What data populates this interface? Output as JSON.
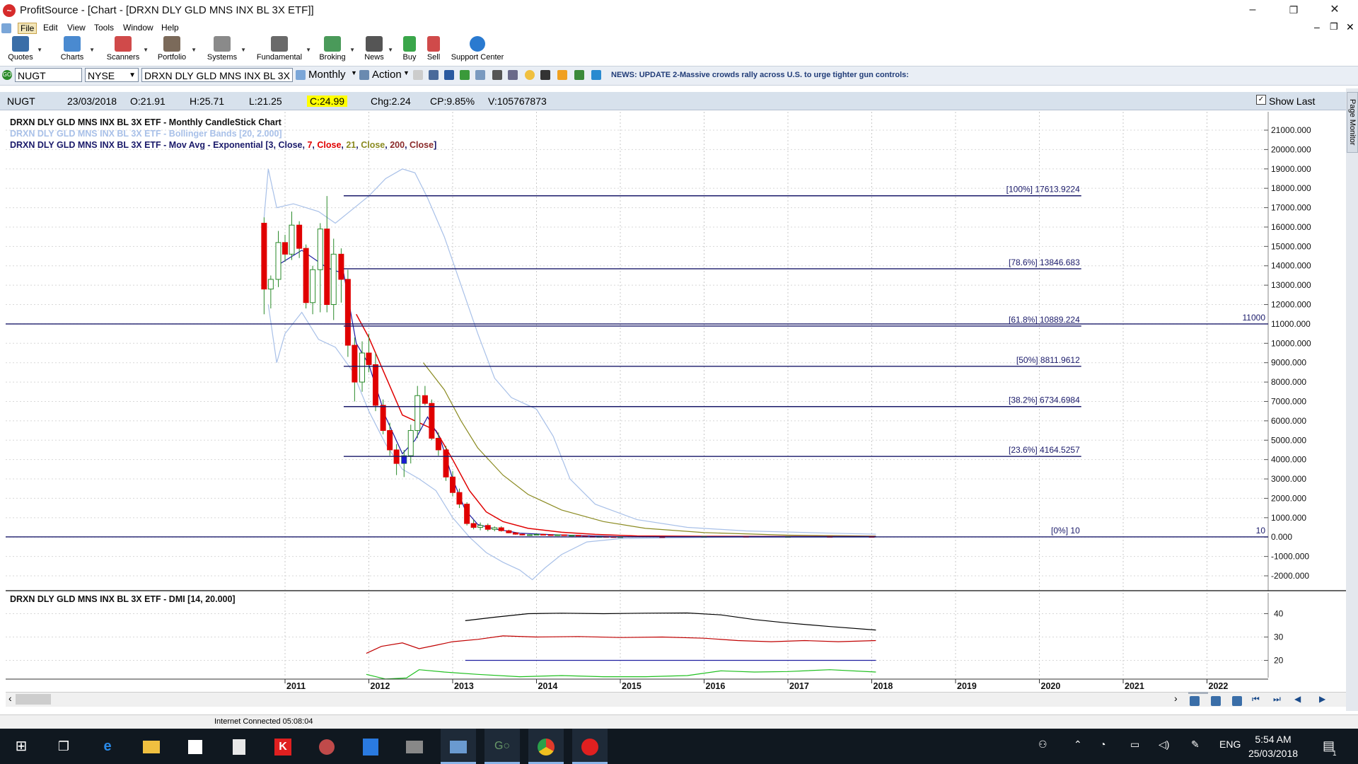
{
  "window": {
    "title": "ProfitSource - [Chart - [DRXN DLY GLD MNS INX BL 3X ETF]]",
    "controls": [
      "–",
      "❐",
      "✕"
    ],
    "mdi_controls": [
      "–",
      "❐",
      "✕"
    ]
  },
  "menu": [
    "File",
    "Edit",
    "View",
    "Tools",
    "Window",
    "Help"
  ],
  "toolbar": [
    {
      "label": "Quotes",
      "icon": "quotes-icon",
      "color": "#3a6ea8"
    },
    {
      "label": "Charts",
      "icon": "charts-icon",
      "color": "#4a8ad0"
    },
    {
      "label": "Scanners",
      "icon": "scanners-icon",
      "color": "#d04a4a"
    },
    {
      "label": "Portfolio",
      "icon": "portfolio-icon",
      "color": "#7b6a5a"
    },
    {
      "label": "Systems",
      "icon": "systems-icon",
      "color": "#8a8a8a"
    },
    {
      "label": "Fundamental",
      "icon": "fundamental-icon",
      "color": "#6a6a6a"
    },
    {
      "label": "Broking",
      "icon": "broking-icon",
      "color": "#4a9a5a"
    },
    {
      "label": "News",
      "icon": "news-icon",
      "color": "#555555"
    },
    {
      "label": "Buy",
      "icon": "buy-icon",
      "color": "#3aa64a"
    },
    {
      "label": "Sell",
      "icon": "sell-icon",
      "color": "#d04a4a"
    },
    {
      "label": "Support Center",
      "icon": "help-icon",
      "color": "#2a7ad0"
    }
  ],
  "symbol_bar": {
    "symbol": "NUGT",
    "exchange": "NYSE",
    "name": "DRXN DLY GLD MNS INX BL 3X",
    "period": "Monthly",
    "action": "Action",
    "news": "NEWS: UPDATE 2-Massive crowds rally across U.S. to urge tighter gun controls:"
  },
  "quote": {
    "symbol": "NUGT",
    "date": "23/03/2018",
    "open": "O:21.91",
    "high": "H:25.71",
    "low": "L:21.25",
    "close": "C:24.99",
    "change": "Chg:2.24",
    "change_pct": "CP:9.85%",
    "volume": "V:105767873",
    "show_last": "Show Last"
  },
  "legends": {
    "main": "DRXN DLY GLD MNS INX BL 3X ETF - Monthly CandleStick Chart",
    "bollinger": "DRXN DLY GLD MNS INX BL 3X ETF - Bollinger Bands [20, 2.000]",
    "ema_prefix": "DRXN DLY GLD MNS INX BL 3X ETF - Mov Avg - Exponential [",
    "ema_parts": [
      "3",
      ", ",
      "Close",
      ", ",
      "7",
      ", ",
      "Close",
      ", ",
      "21",
      ", ",
      "Close",
      ", ",
      "200",
      ", ",
      "Close",
      "]"
    ],
    "dmi": "DRXN DLY GLD MNS INX BL 3X ETF - DMI [14, 20.000]"
  },
  "colors": {
    "up": "#1a1ad0",
    "down": "#e00000",
    "doji": "#2a8a2a",
    "ema3": "#1a1aa0",
    "ema7": "#e00000",
    "ema21": "#8a8a20",
    "ema200": "#8a2a2a",
    "bollinger": "#a8c0e8",
    "fib": "#1a1a6a",
    "dmi_adx": "#000000",
    "dmi_minus": "#c00000",
    "dmi_plus": "#20c020",
    "dmi_level": "#2020a0",
    "quote_close_bg": "#ffff00",
    "news": "#203c78"
  },
  "chart_data": {
    "type": "candlestick",
    "y_axis": {
      "min": -2000,
      "max": 21000,
      "step": 1000,
      "labels": [
        "21000.000",
        "20000.000",
        "19000.000",
        "18000.000",
        "17000.000",
        "16000.000",
        "15000.000",
        "14000.000",
        "13000.000",
        "12000.000",
        "11000.000",
        "10000.000",
        "9000.000",
        "8000.000",
        "7000.000",
        "6000.000",
        "5000.000",
        "4000.000",
        "3000.000",
        "2000.000",
        "1000.000",
        "0.000",
        "-1000.000",
        "-2000.000"
      ]
    },
    "x_axis": {
      "years": [
        "2011",
        "2012",
        "2013",
        "2014",
        "2015",
        "2016",
        "2017",
        "2018",
        "2019",
        "2020",
        "2021",
        "2022"
      ],
      "start": 2010.75,
      "end": 2022.65
    },
    "fib_levels": [
      {
        "label": "[100%] 17613.9224",
        "value": 17613.9224
      },
      {
        "label": "[78.6%] 13846.683",
        "value": 13846.683
      },
      {
        "label": "[61.8%] 10889.224",
        "value": 10889.224
      },
      {
        "label": "[50%] 8811.9612",
        "value": 8811.9612
      },
      {
        "label": "[38.2%] 6734.6984",
        "value": 6734.6984
      },
      {
        "label": "[23.6%] 4164.5257",
        "value": 4164.5257
      },
      {
        "label": "[0%] 10",
        "value": 10
      }
    ],
    "fib_start": 2011.7,
    "fib_end": 2020.5,
    "horizontal_lines": [
      {
        "label": "11000",
        "value": 11000
      },
      {
        "label": "10",
        "value": 10
      }
    ],
    "candles": [
      [
        2010.75,
        16200,
        16500,
        11500,
        12800
      ],
      [
        2010.83,
        12800,
        13500,
        11800,
        13300
      ],
      [
        2010.92,
        13300,
        15800,
        12900,
        15200
      ],
      [
        2011.0,
        15200,
        15600,
        14200,
        14600
      ],
      [
        2011.08,
        14600,
        16800,
        14300,
        16100
      ],
      [
        2011.17,
        16100,
        16300,
        14400,
        14900
      ],
      [
        2011.25,
        14900,
        15100,
        11800,
        12100
      ],
      [
        2011.33,
        12100,
        14000,
        11500,
        13800
      ],
      [
        2011.42,
        13800,
        16200,
        11600,
        15900
      ],
      [
        2011.5,
        15900,
        17600,
        11600,
        12000
      ],
      [
        2011.58,
        12000,
        15400,
        11200,
        14600
      ],
      [
        2011.67,
        14600,
        14900,
        12100,
        13300
      ],
      [
        2011.75,
        13300,
        13800,
        9300,
        9900
      ],
      [
        2011.83,
        9900,
        10300,
        7000,
        8000
      ],
      [
        2011.92,
        8000,
        10100,
        7500,
        9500
      ],
      [
        2012.0,
        9500,
        10500,
        8500,
        8900
      ],
      [
        2012.08,
        8900,
        9500,
        6500,
        6800
      ],
      [
        2012.17,
        6800,
        7100,
        5300,
        5500
      ],
      [
        2012.25,
        5500,
        5900,
        4200,
        4500
      ],
      [
        2012.33,
        4500,
        4800,
        3200,
        3800
      ],
      [
        2012.42,
        3800,
        4500,
        3100,
        4200
      ],
      [
        2012.5,
        4200,
        5800,
        3800,
        5500
      ],
      [
        2012.58,
        5500,
        7800,
        5100,
        7300
      ],
      [
        2012.67,
        7300,
        7800,
        6800,
        6900
      ],
      [
        2012.75,
        6900,
        7100,
        5000,
        5100
      ],
      [
        2012.83,
        5100,
        5400,
        4200,
        4500
      ],
      [
        2012.92,
        4500,
        4700,
        2900,
        3100
      ],
      [
        2013.0,
        3100,
        3400,
        2100,
        2300
      ],
      [
        2013.08,
        2300,
        2500,
        1500,
        1700
      ],
      [
        2013.17,
        1700,
        1800,
        600,
        700
      ],
      [
        2013.25,
        700,
        900,
        400,
        500
      ],
      [
        2013.33,
        500,
        750,
        350,
        600
      ],
      [
        2013.42,
        600,
        700,
        300,
        400
      ],
      [
        2013.5,
        400,
        550,
        300,
        480
      ],
      [
        2013.58,
        480,
        560,
        280,
        330
      ],
      [
        2013.67,
        330,
        380,
        200,
        220
      ],
      [
        2013.75,
        220,
        250,
        120,
        150
      ],
      [
        2013.83,
        150,
        170,
        90,
        110
      ],
      [
        2013.92,
        110,
        140,
        80,
        120
      ],
      [
        2014.0,
        120,
        160,
        100,
        140
      ],
      [
        2014.08,
        140,
        170,
        110,
        120
      ],
      [
        2014.17,
        120,
        130,
        80,
        100
      ],
      [
        2014.25,
        100,
        130,
        90,
        115
      ],
      [
        2014.33,
        115,
        125,
        70,
        80
      ],
      [
        2014.42,
        80,
        100,
        60,
        90
      ],
      [
        2014.5,
        90,
        95,
        50,
        55
      ],
      [
        2014.58,
        55,
        60,
        30,
        35
      ],
      [
        2014.67,
        35,
        40,
        20,
        25
      ],
      [
        2014.75,
        25,
        35,
        15,
        28
      ],
      [
        2014.83,
        28,
        30,
        15,
        18
      ],
      [
        2014.92,
        18,
        22,
        12,
        14
      ],
      [
        2015.0,
        14,
        20,
        12,
        16
      ],
      [
        2015.5,
        16,
        18,
        10,
        12
      ],
      [
        2016.0,
        12,
        40,
        10,
        35
      ],
      [
        2016.5,
        35,
        45,
        20,
        25
      ],
      [
        2017.0,
        25,
        40,
        20,
        30
      ],
      [
        2017.5,
        30,
        35,
        20,
        25
      ],
      [
        2018.0,
        25,
        28,
        20,
        24.99
      ]
    ],
    "ema_3": [
      [
        2010.9,
        14000
      ],
      [
        2011.2,
        14800
      ],
      [
        2011.5,
        13900
      ],
      [
        2011.7,
        13600
      ],
      [
        2011.85,
        10000
      ],
      [
        2012.0,
        8900
      ],
      [
        2012.2,
        6200
      ],
      [
        2012.4,
        4300
      ],
      [
        2012.55,
        5000
      ],
      [
        2012.7,
        6200
      ],
      [
        2012.85,
        5100
      ],
      [
        2013.0,
        3000
      ],
      [
        2013.15,
        1400
      ],
      [
        2013.3,
        650
      ],
      [
        2013.5,
        420
      ],
      [
        2013.8,
        200
      ],
      [
        2014.2,
        120
      ],
      [
        2014.6,
        70
      ],
      [
        2015.0,
        20
      ],
      [
        2016.5,
        28
      ],
      [
        2018.05,
        25
      ]
    ],
    "ema_7": [
      [
        2011.85,
        11500
      ],
      [
        2012.0,
        10300
      ],
      [
        2012.2,
        8300
      ],
      [
        2012.4,
        6300
      ],
      [
        2012.6,
        5900
      ],
      [
        2012.8,
        5500
      ],
      [
        2013.0,
        4000
      ],
      [
        2013.2,
        2400
      ],
      [
        2013.4,
        1300
      ],
      [
        2013.6,
        800
      ],
      [
        2013.9,
        450
      ],
      [
        2014.3,
        250
      ],
      [
        2014.7,
        140
      ],
      [
        2015.2,
        60
      ],
      [
        2016.0,
        40
      ],
      [
        2018.05,
        28
      ]
    ],
    "ema_21": [
      [
        2012.65,
        9000
      ],
      [
        2012.9,
        7600
      ],
      [
        2013.1,
        6000
      ],
      [
        2013.3,
        4600
      ],
      [
        2013.6,
        3200
      ],
      [
        2013.9,
        2200
      ],
      [
        2014.3,
        1400
      ],
      [
        2014.8,
        800
      ],
      [
        2015.3,
        450
      ],
      [
        2016.0,
        230
      ],
      [
        2017.0,
        100
      ],
      [
        2018.05,
        50
      ]
    ],
    "boll_upper": [
      [
        2010.75,
        16500
      ],
      [
        2010.8,
        19000
      ],
      [
        2010.9,
        17000
      ],
      [
        2011.1,
        17200
      ],
      [
        2011.4,
        16800
      ],
      [
        2011.6,
        16200
      ],
      [
        2011.8,
        16900
      ],
      [
        2012.0,
        17600
      ],
      [
        2012.2,
        18500
      ],
      [
        2012.4,
        19000
      ],
      [
        2012.55,
        18800
      ],
      [
        2012.7,
        17500
      ],
      [
        2012.9,
        15500
      ],
      [
        2013.1,
        13000
      ],
      [
        2013.3,
        10500
      ],
      [
        2013.5,
        8200
      ],
      [
        2013.7,
        7200
      ],
      [
        2014.0,
        6600
      ],
      [
        2014.2,
        5200
      ],
      [
        2014.4,
        3000
      ],
      [
        2014.7,
        1700
      ],
      [
        2015.2,
        900
      ],
      [
        2015.8,
        500
      ],
      [
        2016.5,
        320
      ],
      [
        2017.5,
        200
      ],
      [
        2018.05,
        150
      ]
    ],
    "boll_lower": [
      [
        2010.8,
        12000
      ],
      [
        2010.9,
        9000
      ],
      [
        2011.0,
        10500
      ],
      [
        2011.2,
        11600
      ],
      [
        2011.4,
        10200
      ],
      [
        2011.6,
        9800
      ],
      [
        2011.8,
        8600
      ],
      [
        2012.0,
        6500
      ],
      [
        2012.2,
        4800
      ],
      [
        2012.4,
        3500
      ],
      [
        2012.6,
        3000
      ],
      [
        2012.8,
        2400
      ],
      [
        2013.0,
        1000
      ],
      [
        2013.2,
        0
      ],
      [
        2013.4,
        -800
      ],
      [
        2013.6,
        -1300
      ],
      [
        2013.8,
        -1700
      ],
      [
        2013.95,
        -2200
      ],
      [
        2014.1,
        -1600
      ],
      [
        2014.3,
        -900
      ],
      [
        2014.6,
        -250
      ],
      [
        2015.0,
        -80
      ],
      [
        2015.6,
        -40
      ],
      [
        2016.4,
        -5
      ],
      [
        2017.2,
        -10
      ],
      [
        2018.05,
        -5
      ]
    ],
    "dmi": {
      "y_axis": {
        "min": 10,
        "max": 45,
        "labels": [
          "40",
          "30",
          "20"
        ],
        "ticks": [
          40,
          30,
          20
        ]
      },
      "adx": [
        [
          2013.15,
          37
        ],
        [
          2013.5,
          38.5
        ],
        [
          2013.9,
          40
        ],
        [
          2014.3,
          40.2
        ],
        [
          2014.8,
          40
        ],
        [
          2015.3,
          40.2
        ],
        [
          2015.8,
          40.3
        ],
        [
          2016.2,
          39.5
        ],
        [
          2016.6,
          37.5
        ],
        [
          2017.0,
          36
        ],
        [
          2017.5,
          34.5
        ],
        [
          2018.05,
          33
        ]
      ],
      "minus_di": [
        [
          2011.97,
          23
        ],
        [
          2012.15,
          26
        ],
        [
          2012.4,
          27.5
        ],
        [
          2012.6,
          25
        ],
        [
          2012.8,
          26.5
        ],
        [
          2013.0,
          28
        ],
        [
          2013.3,
          29
        ],
        [
          2013.6,
          30.5
        ],
        [
          2014.0,
          30
        ],
        [
          2014.5,
          30.2
        ],
        [
          2015.0,
          29.8
        ],
        [
          2015.5,
          30
        ],
        [
          2016.0,
          29.5
        ],
        [
          2016.4,
          28.5
        ],
        [
          2016.8,
          28
        ],
        [
          2017.2,
          28.5
        ],
        [
          2017.6,
          28
        ],
        [
          2018.05,
          28.5
        ]
      ],
      "plus_di": [
        [
          2011.97,
          14
        ],
        [
          2012.2,
          12
        ],
        [
          2012.45,
          12.5
        ],
        [
          2012.6,
          16
        ],
        [
          2012.9,
          15
        ],
        [
          2013.3,
          14
        ],
        [
          2013.8,
          13
        ],
        [
          2014.3,
          13.5
        ],
        [
          2014.8,
          13
        ],
        [
          2015.3,
          13
        ],
        [
          2015.8,
          13.5
        ],
        [
          2016.2,
          15.5
        ],
        [
          2016.6,
          15
        ],
        [
          2017.0,
          15.2
        ],
        [
          2017.5,
          16
        ],
        [
          2018.05,
          15
        ]
      ],
      "level": 20
    }
  },
  "status": {
    "connection": "Internet Connected 05:08:04"
  },
  "side_panel": {
    "label": "Page Monitor"
  },
  "taskbar": {
    "apps": [
      "windows-start-icon",
      "task-view-icon",
      "edge-icon",
      "file-explorer-icon",
      "store-icon",
      "calculator-icon",
      "kaspersky-icon",
      "app-icon",
      "defender-icon",
      "camera-app-icon",
      "image-viewer-icon",
      "go-app-icon",
      "chrome-icon",
      "profitsource-icon"
    ],
    "lang": "ENG",
    "time": "5:54 AM",
    "date": "25/03/2018",
    "notifications": "1"
  }
}
